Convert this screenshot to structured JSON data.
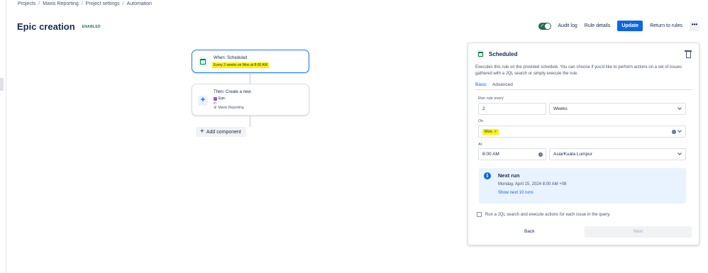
{
  "breadcrumb": [
    "Projects",
    "Maxis Reporting",
    "Project settings",
    "Automation"
  ],
  "header": {
    "title": "Epic creation",
    "status": "ENABLED",
    "audit_log": "Audit log",
    "rule_details": "Rule details",
    "update": "Update",
    "return_to_rules": "Return to rules",
    "more": "•••"
  },
  "flow": {
    "trigger": {
      "title": "When: Scheduled",
      "detail": "Every 2 weeks on Mon at 8:00 AM"
    },
    "action": {
      "title": "Then: Create a new",
      "issue_type": "Epic",
      "in_label": "in",
      "project": "Maxis Reporting"
    },
    "add_component": "Add component"
  },
  "panel": {
    "title": "Scheduled",
    "description": "Executes this rule on the provided schedule. You can choose if you'd like to perform actions on a set of issues gathered with a JQL search or simply execute the rule.",
    "tabs": [
      {
        "label": "Basic",
        "active": true
      },
      {
        "label": "Advanced",
        "active": false
      }
    ],
    "run_rule_every": {
      "label": "Run rule every",
      "value": "2",
      "unit": "Weeks"
    },
    "on": {
      "label": "On",
      "value": "Mon"
    },
    "at": {
      "label": "At",
      "time": "8:00 AM",
      "timezone": "Asia/Kuala Lumpur"
    },
    "next_run": {
      "title": "Next run",
      "date": "Monday, April 15, 2024 8:00 AM +08",
      "link": "Show next 10 runs"
    },
    "jql_checkbox": {
      "label": "Run a JQL search and execute actions for each issue in the query.",
      "checked": false
    },
    "back": "Back",
    "next": "Next"
  },
  "colors": {
    "accent": "#0c66e4",
    "enabled": "#216e4e",
    "highlight": "#fff200"
  }
}
